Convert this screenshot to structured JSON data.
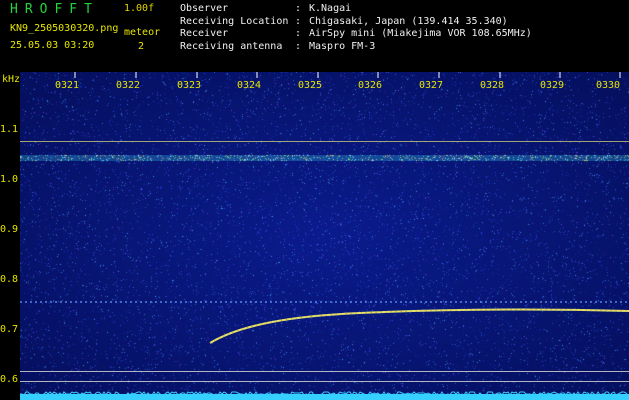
{
  "header": {
    "title": "HROFFT",
    "version": "1.00f",
    "filename": "KN9_2505030320.png",
    "datetime": "25.05.03 03:20",
    "meteor_label": "meteor",
    "meteor_count": "2"
  },
  "info": [
    {
      "key": "Observer",
      "value": "K.Nagai"
    },
    {
      "key": "Receiving Location",
      "value": "Chigasaki, Japan (139.414 35.340)"
    },
    {
      "key": "Receiver",
      "value": "AirSpy mini (Miakejima VOR 108.65MHz)"
    },
    {
      "key": "Receiving antenna",
      "value": "Maspro FM-3"
    }
  ],
  "axis": {
    "unit": "kHz",
    "y_ticks": [
      "1.1",
      "1.0",
      "0.9",
      "0.8",
      "0.7",
      "0.6"
    ],
    "x_ticks": [
      "0321",
      "0322",
      "0323",
      "0324",
      "0325",
      "0326",
      "0327",
      "0328",
      "0329",
      "0330"
    ]
  },
  "colors": {
    "background": "#000000",
    "plot": "#0a1a8a",
    "label": "#e6e600",
    "title": "#25d43a",
    "spectrum": "#35d0ff"
  }
}
